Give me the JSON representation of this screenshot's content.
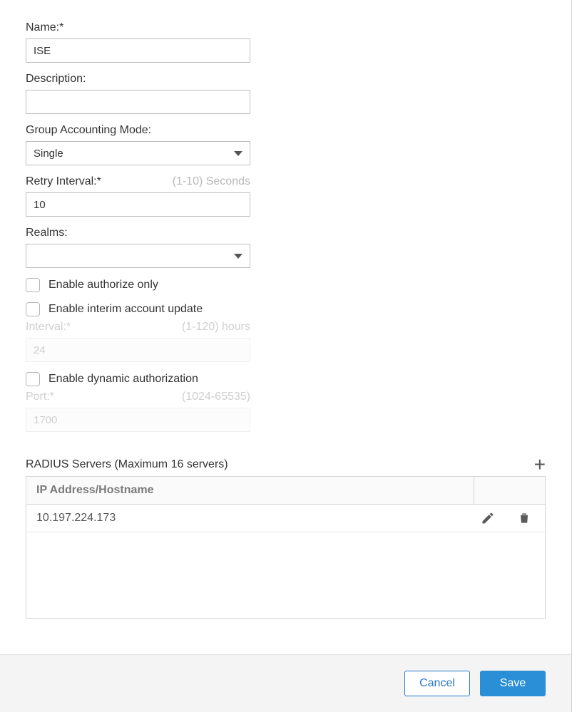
{
  "fields": {
    "name": {
      "label": "Name:*",
      "value": "ISE"
    },
    "description": {
      "label": "Description:",
      "value": ""
    },
    "group_accounting_mode": {
      "label": "Group Accounting Mode:",
      "value": "Single"
    },
    "retry_interval": {
      "label": "Retry Interval:*",
      "hint": "(1-10) Seconds",
      "value": "10"
    },
    "realms": {
      "label": "Realms:",
      "value": ""
    },
    "enable_authorize_only": {
      "label": "Enable authorize only",
      "checked": false
    },
    "enable_interim_account_update": {
      "label": "Enable interim account update",
      "checked": false
    },
    "interval": {
      "label": "Interval:*",
      "hint": "(1-120) hours",
      "value": "24"
    },
    "enable_dynamic_authorization": {
      "label": "Enable dynamic authorization",
      "checked": false
    },
    "port": {
      "label": "Port:*",
      "hint": "(1024-65535)",
      "value": "1700"
    }
  },
  "servers": {
    "title": "RADIUS Servers (Maximum 16 servers)",
    "column_header": "IP Address/Hostname",
    "rows": [
      {
        "ip": "10.197.224.173"
      }
    ]
  },
  "footer": {
    "cancel": "Cancel",
    "save": "Save"
  }
}
